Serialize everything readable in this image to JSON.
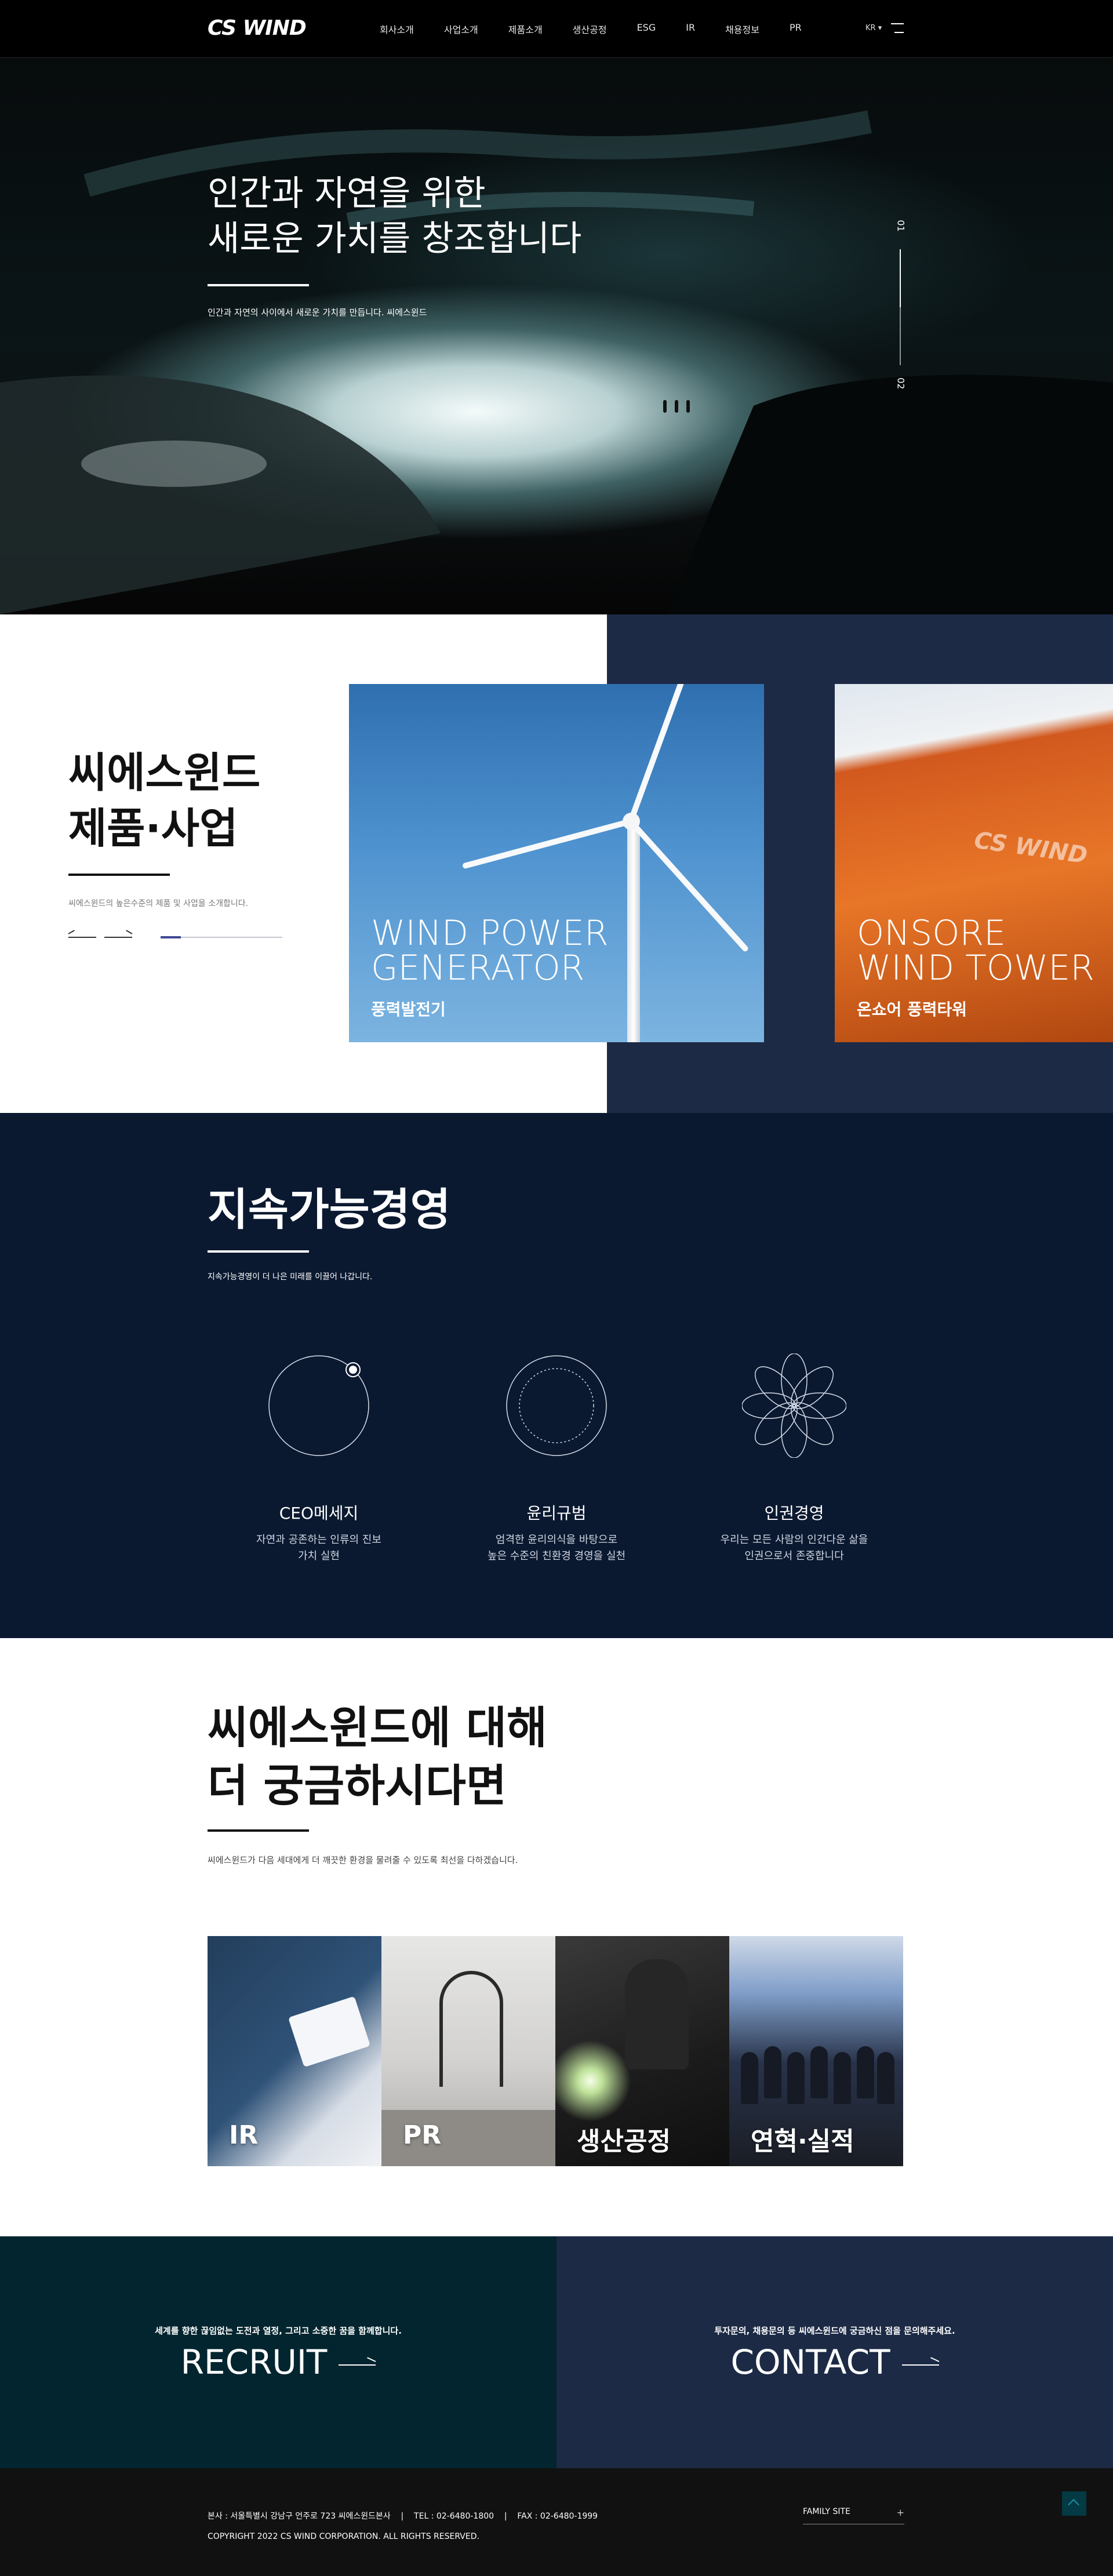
{
  "header": {
    "logo": "CS WIND",
    "nav": [
      "회사소개",
      "사업소개",
      "제품소개",
      "생산공정",
      "ESG",
      "IR",
      "채용정보",
      "PR"
    ],
    "lang": "KR ▾"
  },
  "hero": {
    "title_line1": "인간과 자연을 위한",
    "title_line2": "새로운 가치를 창조합니다",
    "subtitle": "인간과 자연의 사이에서 새로운 가치를 만듭니다. 씨에스윈드",
    "indicator_current": "01",
    "indicator_total": "02"
  },
  "products": {
    "title_line1": "씨에스윈드",
    "title_line2": "제품·사업",
    "subtitle": "씨에스윈드의 높은수준의 제품 및 사업을 소개합니다.",
    "cards": [
      {
        "en_line1": "WIND POWER",
        "en_line2": "GENERATOR",
        "ko": "풍력발전기"
      },
      {
        "en_line1": "ONSORE",
        "en_line2": "WIND TOWER",
        "ko": "온쇼어 풍력타워",
        "logo": "CS WIND"
      }
    ]
  },
  "sustainability": {
    "title": "지속가능경영",
    "subtitle": "지속가능경영이 더 나은 미래를 이끌어 나갑니다.",
    "items": [
      {
        "name": "CEO메세지",
        "desc1": "자연과 공존하는 인류의 진보",
        "desc2": "가치 실현"
      },
      {
        "name": "윤리규범",
        "desc1": "엄격한 윤리의식을 바탕으로",
        "desc2": "높은 수준의 친환경 경영을 실천"
      },
      {
        "name": "인권경영",
        "desc1": "우리는 모든 사람의 인간다운 삶을",
        "desc2": "인권으로서 존중합니다"
      }
    ]
  },
  "about": {
    "title_line1": "씨에스윈드에 대해",
    "title_line2": "더 궁금하시다면",
    "subtitle": "씨에스윈드가 다음 세대에게 더 깨끗한 환경을 물려줄 수 있도록 최선을 다하겠습니다.",
    "tiles": [
      "IR",
      "PR",
      "생산공정",
      "연혁·실적"
    ]
  },
  "recruit": {
    "sub": "세계를 향한 끊임없는 도전과 열정, 그리고 소중한 꿈을 함께합니다.",
    "title": "RECRUIT"
  },
  "contact": {
    "sub": "투자문의, 채용문의 등 씨에스윈드에 궁금하신 점을 문의해주세요.",
    "title": "CONTACT"
  },
  "footer": {
    "address": "본사 : 서울특별시 강남구 언주로 723 씨에스윈드본사    |    TEL : 02-6480-1800    |    FAX : 02-6480-1999",
    "copyright": "COPYRIGHT 2022 CS WIND CORPORATION. ALL RIGHTS RESERVED.",
    "family_site": "FAMILY SITE",
    "family_plus": "+"
  }
}
